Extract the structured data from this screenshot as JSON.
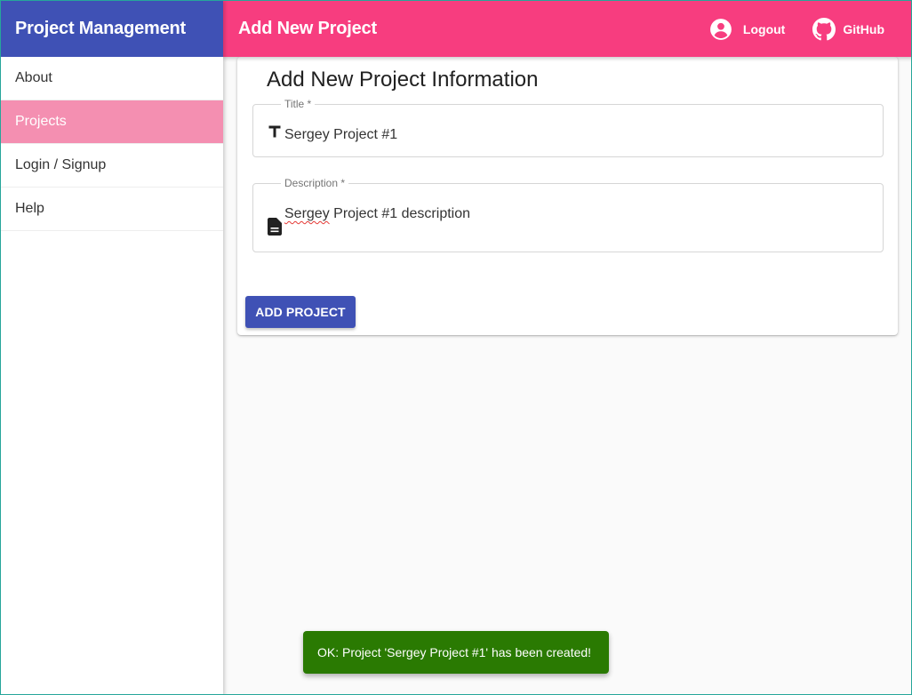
{
  "sidebar": {
    "title": "Project Management",
    "items": [
      {
        "label": "About",
        "active": false
      },
      {
        "label": "Projects",
        "active": true
      },
      {
        "label": "Login / Signup",
        "active": false
      },
      {
        "label": "Help",
        "active": false
      }
    ]
  },
  "topbar": {
    "title": "Add New Project",
    "logout_label": "Logout",
    "logout_icon": "account-circle-icon",
    "github_label": "GitHub",
    "github_icon": "github-icon"
  },
  "form": {
    "heading": "Add New Project Information",
    "title_field": {
      "label": "Title *",
      "value": "Sergey Project #1",
      "icon": "text-title-icon"
    },
    "description_field": {
      "label": "Description *",
      "value_first_word": "Sergey",
      "value_rest": " Project #1 description",
      "icon": "document-icon"
    },
    "submit_label": "ADD PROJECT"
  },
  "snackbar": {
    "message": "OK: Project 'Sergey Project #1' has been created!"
  },
  "colors": {
    "sidebar_header": "#3f51b5",
    "topbar": "#f73d7f",
    "active_nav": "#f48fb1",
    "primary_button": "#3f51b5",
    "snackbar": "#2a7a02"
  }
}
